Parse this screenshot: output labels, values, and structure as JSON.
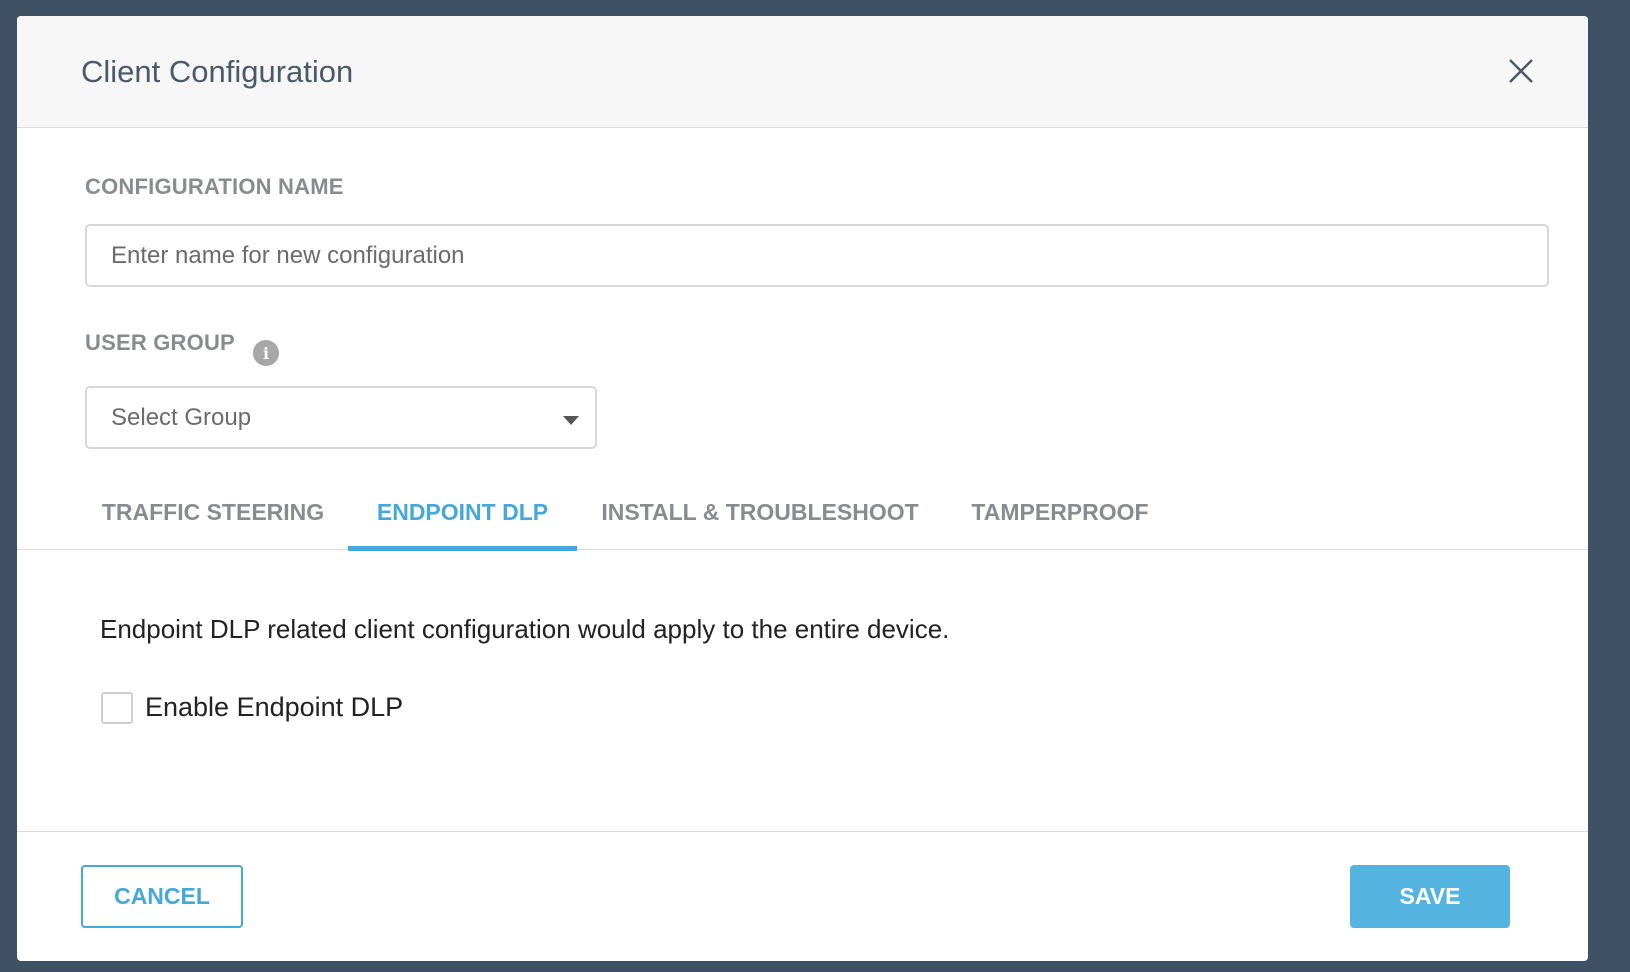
{
  "modal": {
    "title": "Client Configuration",
    "close_icon": "close-icon"
  },
  "form": {
    "config_name_label": "CONFIGURATION NAME",
    "config_name_placeholder": "Enter name for new configuration",
    "config_name_value": "",
    "user_group_label": "USER GROUP",
    "user_group_info_icon": "info-icon",
    "user_group_info_glyph": "i",
    "user_group_selected": "Select Group"
  },
  "tabs": [
    {
      "label": "TRAFFIC STEERING",
      "active": false
    },
    {
      "label": "ENDPOINT DLP",
      "active": true
    },
    {
      "label": "INSTALL & TROUBLESHOOT",
      "active": false
    },
    {
      "label": "TAMPERPROOF",
      "active": false
    }
  ],
  "endpoint_dlp": {
    "description": "Endpoint DLP related client configuration would apply to the entire device.",
    "enable_label": "Enable Endpoint DLP",
    "enable_checked": false
  },
  "footer": {
    "cancel_label": "CANCEL",
    "save_label": "SAVE"
  },
  "colors": {
    "accent": "#45a8d8",
    "save_bg": "#55b4df",
    "backdrop": "#3f5165"
  }
}
